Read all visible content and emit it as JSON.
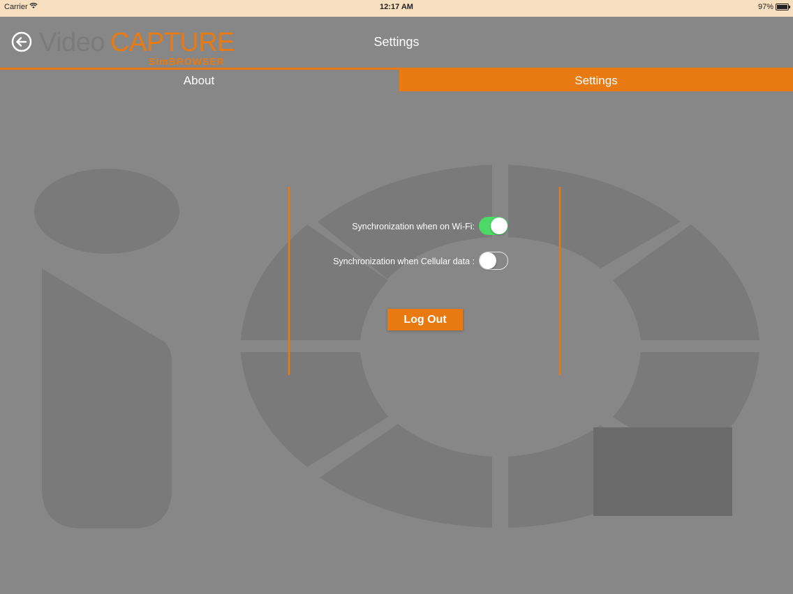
{
  "status_bar": {
    "carrier": "Carrier",
    "time": "12:17 AM",
    "battery_percent": "97%",
    "battery_level": 0.97
  },
  "header": {
    "logo_video": "Video",
    "logo_capture": "CAPTURE",
    "logo_sub": "SimBROWSER",
    "title": "Settings",
    "back_icon": "arrow-left-circle-icon"
  },
  "tabs": [
    {
      "label": "About",
      "active": false
    },
    {
      "label": "Settings",
      "active": true
    }
  ],
  "settings": {
    "wifi_sync": {
      "label": "Synchronization when on Wi-Fi:",
      "enabled": true
    },
    "cellular_sync": {
      "label": "Synchronization when Cellular data :",
      "enabled": false
    }
  },
  "logout": {
    "label": "Log Out"
  },
  "colors": {
    "accent": "#e97a12",
    "background": "#878787",
    "toggle_on": "#4cd964",
    "status_bar": "#f7dfc0"
  }
}
